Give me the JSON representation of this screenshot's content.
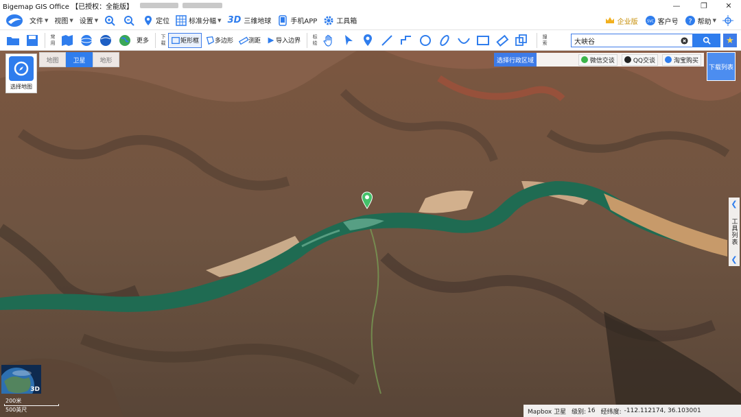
{
  "window": {
    "title": "Bigemap GIS Office 【已授权：全能版】",
    "minimize": "—",
    "restore": "❐",
    "close": "✕"
  },
  "menu": {
    "file": "文件",
    "view": "视图",
    "settings": "设置",
    "locate": "定位",
    "standard_sheets": "标准分幅",
    "three_d_label": "3D",
    "three_d_globe": "三维地球",
    "mobile_app": "手机APP",
    "toolbox": "工具箱",
    "enterprise": "企业版",
    "account": "客户号",
    "help": "帮助"
  },
  "toolbar": {
    "common_label": "常用",
    "more": "更多",
    "download_label": "下载",
    "rectangle": "矩形框",
    "polygon": "多边形",
    "measure": "测距",
    "import_boundary": "导入边界",
    "annotate_label": "标绘",
    "search_label": "搜索",
    "search_value": "大峡谷"
  },
  "map": {
    "choose_map": "选择地图",
    "tabs": [
      {
        "label": "地图",
        "active": false
      },
      {
        "label": "卫星",
        "active": true
      },
      {
        "label": "地形",
        "active": false
      }
    ],
    "select_region": "选择行政区域",
    "wechat": "微信交谈",
    "qq": "QQ交谈",
    "taobao": "淘宝购买",
    "download_list": "下载列表",
    "tool_list": "工具列表",
    "globe_3d": "3D",
    "scale_top": "200米",
    "scale_bottom": "500英尺"
  },
  "status": {
    "source": "Mapbox 卫星",
    "level_label": "级别:",
    "level": "16",
    "coord_label": "经纬度:",
    "coords": "-112.112174, 36.103001"
  },
  "colors": {
    "accent": "#2f7ded",
    "river": "#1f6b52",
    "sediment": "#c79a6a"
  }
}
